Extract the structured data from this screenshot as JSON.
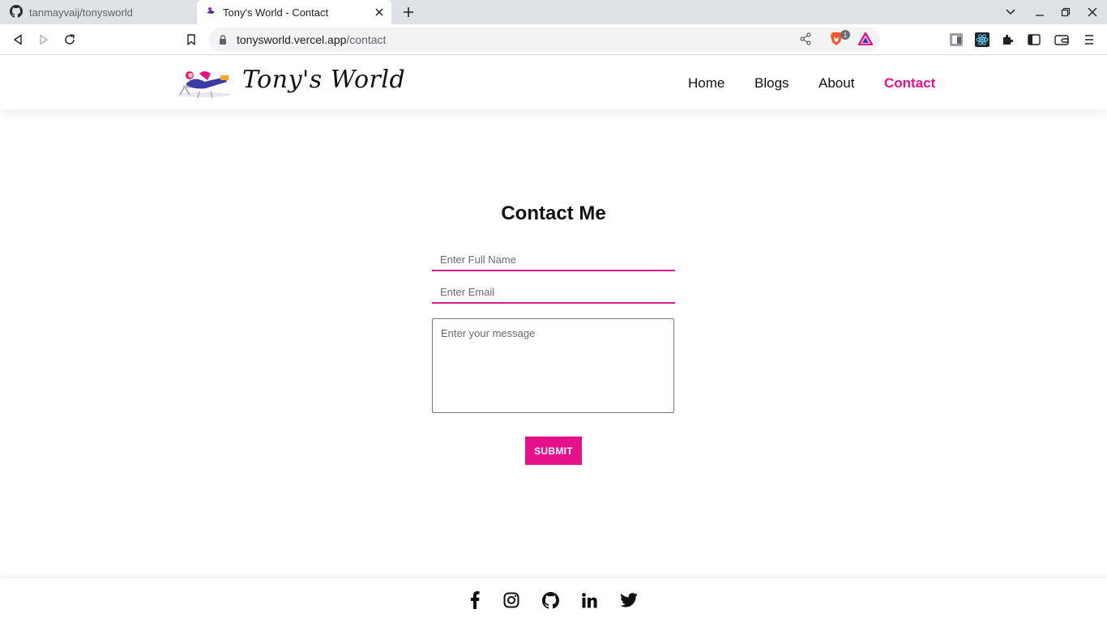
{
  "browser": {
    "tabs": [
      {
        "title": "tanmayvaij/tonysworld",
        "icon": "github-icon"
      },
      {
        "title": "Tony's World - Contact",
        "icon": "site-favicon"
      }
    ],
    "url_host": "tonysworld.vercel.app",
    "url_path": "/contact",
    "shields_count": "1"
  },
  "site": {
    "logo_text": "Tony's World",
    "nav": [
      {
        "label": "Home"
      },
      {
        "label": "Blogs"
      },
      {
        "label": "About"
      },
      {
        "label": "Contact",
        "active": true
      }
    ],
    "accent_color": "#e6108a"
  },
  "contact": {
    "title": "Contact Me",
    "name_placeholder": "Enter Full Name",
    "email_placeholder": "Enter Email",
    "message_placeholder": "Enter your message",
    "submit_label": "SUBMIT"
  },
  "footer": {
    "social_icons": [
      "facebook-icon",
      "instagram-icon",
      "github-icon",
      "linkedin-icon",
      "twitter-icon"
    ]
  }
}
